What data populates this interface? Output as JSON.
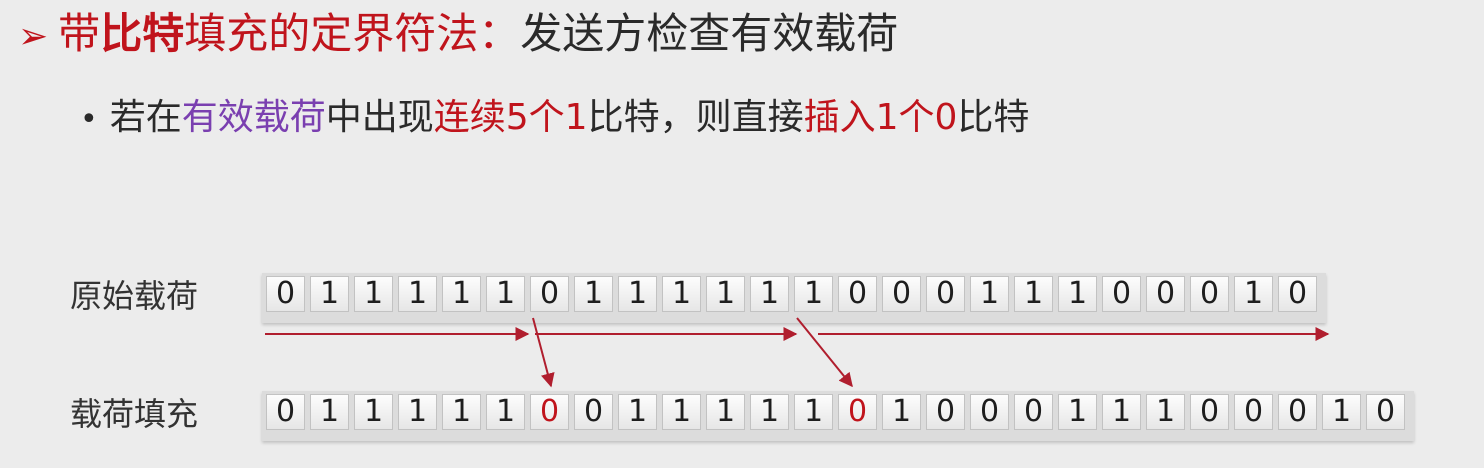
{
  "heading": {
    "marker": "➢",
    "part1": "带",
    "part2": "比特",
    "part3": "填充的定界符法：",
    "part4": "发送方检查有效载荷"
  },
  "bullet": {
    "dot": "•",
    "t1": "若在",
    "t2": "有效载荷",
    "t3": "中出现",
    "t4": "连续5个1",
    "t5": "比特，则直接",
    "t6": "插入1个0",
    "t7": "比特"
  },
  "rows": {
    "original_label": "原始载荷",
    "stuffed_label": "载荷填充"
  },
  "original_bits": [
    "0",
    "1",
    "1",
    "1",
    "1",
    "1",
    "0",
    "1",
    "1",
    "1",
    "1",
    "1",
    "1",
    "0",
    "0",
    "0",
    "1",
    "1",
    "1",
    "0",
    "0",
    "0",
    "1",
    "0"
  ],
  "stuffed_bits": [
    "0",
    "1",
    "1",
    "1",
    "1",
    "1",
    "0",
    "0",
    "1",
    "1",
    "1",
    "1",
    "1",
    "0",
    "1",
    "0",
    "0",
    "0",
    "1",
    "1",
    "1",
    "0",
    "0",
    "0",
    "1",
    "0"
  ],
  "stuffed_positions": [
    6,
    13
  ],
  "colors": {
    "accent": "#c0141c",
    "purple": "#7a3fb0",
    "arrow": "#b01e2e"
  }
}
